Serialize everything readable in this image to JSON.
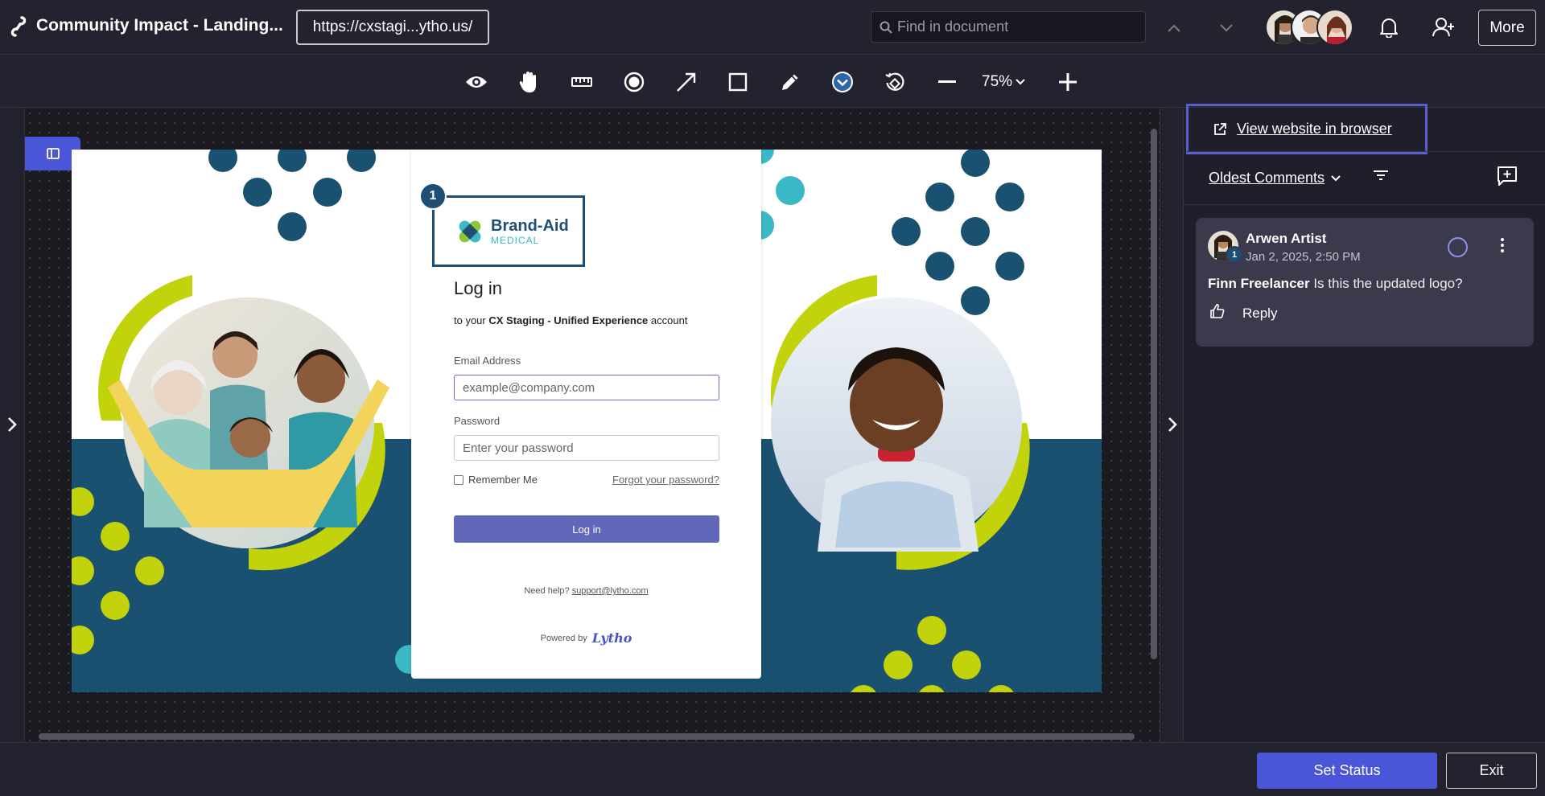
{
  "header": {
    "title": "Community Impact - Landing...",
    "url": "https://cxstagi...ytho.us/",
    "find_placeholder": "Find in document",
    "more_label": "More"
  },
  "toolbar": {
    "tools": [
      "eye-icon",
      "hand-icon",
      "ruler-icon",
      "record-icon",
      "arrow-icon",
      "rectangle-icon",
      "pencil-icon",
      "pin-dropdown-icon",
      "rotate-icon",
      "zoom-out-icon"
    ],
    "zoom_label": "75%"
  },
  "preview": {
    "pin_number": "1",
    "brand_name": "Brand-Aid",
    "brand_sub": "MEDICAL",
    "login_title": "Log in",
    "login_sub_prefix": "to your ",
    "login_sub_bold": "CX Staging - Unified Experience",
    "login_sub_suffix": " account",
    "email_label": "Email Address",
    "email_placeholder": "example@company.com",
    "password_label": "Password",
    "password_placeholder": "Enter your password",
    "remember_label": "Remember Me",
    "forgot_label": "Forgot your password?",
    "login_button": "Log in",
    "help_prefix": "Need help? ",
    "help_email": "support@lytho.com",
    "powered_by": "Powered by",
    "powered_brand": "Lytho"
  },
  "sidebar": {
    "view_website": "View website in browser",
    "sort_label": "Oldest Comments",
    "comments": [
      {
        "author": "Arwen Artist",
        "badge": "1",
        "date": "Jan 2, 2025, 2:50 PM",
        "mention": "Finn Freelancer",
        "text": " Is this the updated logo?",
        "reply_label": "Reply"
      }
    ]
  },
  "footer": {
    "set_status": "Set Status",
    "exit": "Exit"
  },
  "colors": {
    "accent": "#4b55d8",
    "navy": "#1a5070",
    "lime": "#c2d30c",
    "teal": "#3bb8c6"
  }
}
